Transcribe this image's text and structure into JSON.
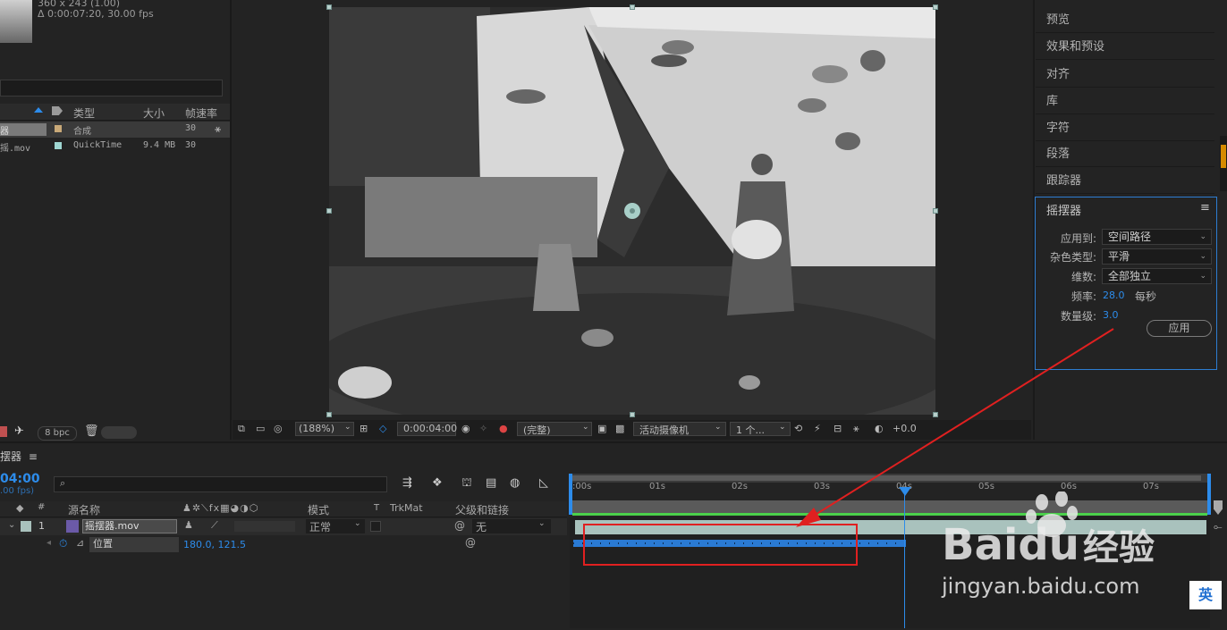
{
  "project": {
    "thumb_info_line1": "360 x 243 (1.00)",
    "thumb_info_line2": "Δ 0:00:07:20, 30.00 fps",
    "columns": [
      "类型",
      "大小",
      "帧速率"
    ],
    "items": [
      {
        "name": "器",
        "type": "合成",
        "size": "",
        "fps": "30"
      },
      {
        "name": "摇.mov",
        "type": "QuickTime",
        "size": "9.4 MB",
        "fps": "30"
      }
    ],
    "bpc": "8 bpc"
  },
  "viewer": {
    "zoom": "(188%)",
    "timecode": "0:00:04:00",
    "resolution": "(完整)",
    "camera": "活动摄像机",
    "views": "1 个...",
    "exposure": "+0.0"
  },
  "right_panels": {
    "items": [
      "预览",
      "效果和预设",
      "对齐",
      "库",
      "字符",
      "段落",
      "跟踪器"
    ],
    "wiggler": {
      "title": "摇摆器",
      "apply_to_label": "应用到:",
      "apply_to_value": "空间路径",
      "noise_type_label": "杂色类型:",
      "noise_type_value": "平滑",
      "dimensions_label": "维数:",
      "dimensions_value": "全部独立",
      "frequency_label": "频率:",
      "frequency_value": "28.0",
      "frequency_unit": "每秒",
      "magnitude_label": "数量级:",
      "magnitude_value": "3.0",
      "apply_button": "应用"
    }
  },
  "timeline": {
    "comp_name": "摆器",
    "current_time": "04:00",
    "fps_hint": ".00 fps)",
    "columns": {
      "num": "#",
      "source_name": "源名称",
      "mode": "模式",
      "t": "T",
      "trkmat": "TrkMat",
      "parent": "父级和链接"
    },
    "layer": {
      "index": "1",
      "name": "摇摆器.mov",
      "mode": "正常",
      "parent": "无"
    },
    "property": {
      "name": "位置",
      "value": "180.0, 121.5"
    },
    "ruler_labels": [
      ":00s",
      "01s",
      "02s",
      "03s",
      "04s",
      "05s",
      "06s",
      "07s"
    ]
  },
  "watermark": {
    "brand": "Baidu",
    "brand_cn": "经验",
    "url": "jingyan.baidu.com"
  },
  "ime": "英",
  "colors": {
    "accent": "#2d8ceb",
    "highlight_box": "#e02020",
    "layer_bar": "#a9c2bd",
    "panel_border": "#2d7dd2"
  }
}
